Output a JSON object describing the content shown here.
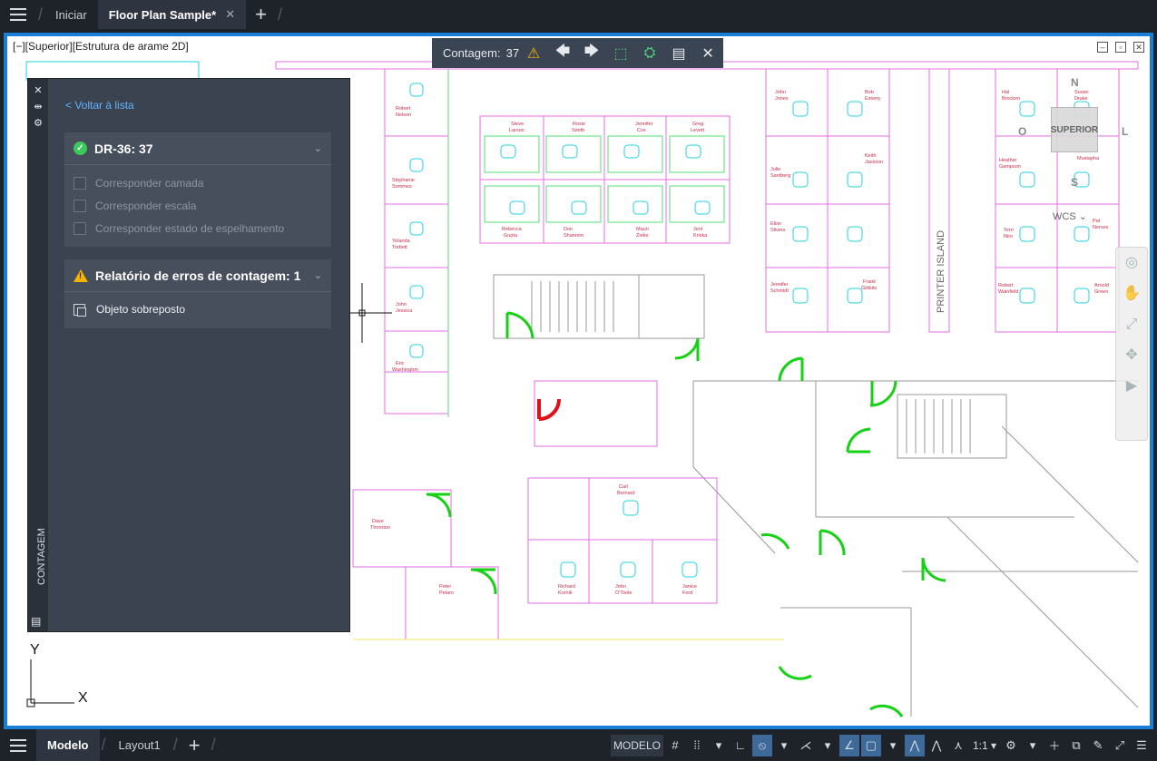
{
  "tabs": {
    "home_label": "Iniciar",
    "active_label": "Floor Plan Sample*",
    "close_glyph": "✕",
    "add_glyph": "+"
  },
  "viewport": {
    "label": "[−][Superior][Estrutura de arame 2D]"
  },
  "count_toolbar": {
    "label": "Contagem:",
    "value": "37",
    "icons": [
      "warning-icon",
      "arrow-left-icon",
      "arrow-right-icon",
      "zoom-extents-icon",
      "count-object-icon",
      "table-icon",
      "close-icon"
    ]
  },
  "palette": {
    "title": "CONTAGEM",
    "back_link": "< Voltar à lista",
    "block_section": {
      "title": "DR-36: 37",
      "options": [
        "Corresponder camada",
        "Corresponder escala",
        "Corresponder estado de espelhamento"
      ]
    },
    "error_section": {
      "title": "Relatório de erros de contagem: 1",
      "items": [
        "Objeto sobreposto"
      ]
    }
  },
  "drawing": {
    "labels": {
      "printer_island": "PRINTER ISLAND",
      "names_top": [
        "Steve Larson",
        "Rosie Smith",
        "Jennifer Cox",
        "Greg Levett"
      ],
      "names_bottom": [
        "Rebecca Gupta",
        "Don Shannon",
        "Mauri Zieke",
        "Jeni Kriska"
      ],
      "names_left": [
        "Robert Nelson",
        "Stephanie Sommes",
        "Yolanda Torbett",
        "John Jessica",
        "Eric Washington"
      ],
      "names_right1": [
        "John Jones",
        "Julie Santberg",
        "Elise Slivers",
        "Jennifer Schmidt"
      ],
      "names_right2": [
        "Bob Esterry",
        "Keith Jackson",
        "Frank Gibbits"
      ],
      "names_far": [
        "Hal Brocken",
        "Heather Gampson",
        "Terri Niro",
        "Robert Wainfield"
      ],
      "names_far2": [
        "Susan Drake",
        "Mustapha",
        "Pat Nerses",
        "Arnold Green"
      ],
      "names_center": [
        "Carl Bernard",
        "Richard Kornik",
        "John O'Toole",
        "Janice Ford"
      ],
      "names_low_left": [
        "Dave Thornton",
        "Peter Pelaro"
      ]
    }
  },
  "navigation": {
    "cube_label": "SUPERIOR",
    "compass": {
      "n": "N",
      "s": "S",
      "l": "L",
      "o": "O"
    },
    "wcs_label": "WCS"
  },
  "ucs": {
    "x": "X",
    "y": "Y"
  },
  "status_bar": {
    "model_tab": "Modelo",
    "layout_tab": "Layout1",
    "mode": "MODELO",
    "scale": "1:1"
  },
  "colors": {
    "accent": "#1a7fd6",
    "door_green": "#16d116",
    "door_red": "#e0101a",
    "wall_magenta": "#e46ee4",
    "cubicle_green": "#55dd77",
    "cyan": "#22d2e6"
  }
}
